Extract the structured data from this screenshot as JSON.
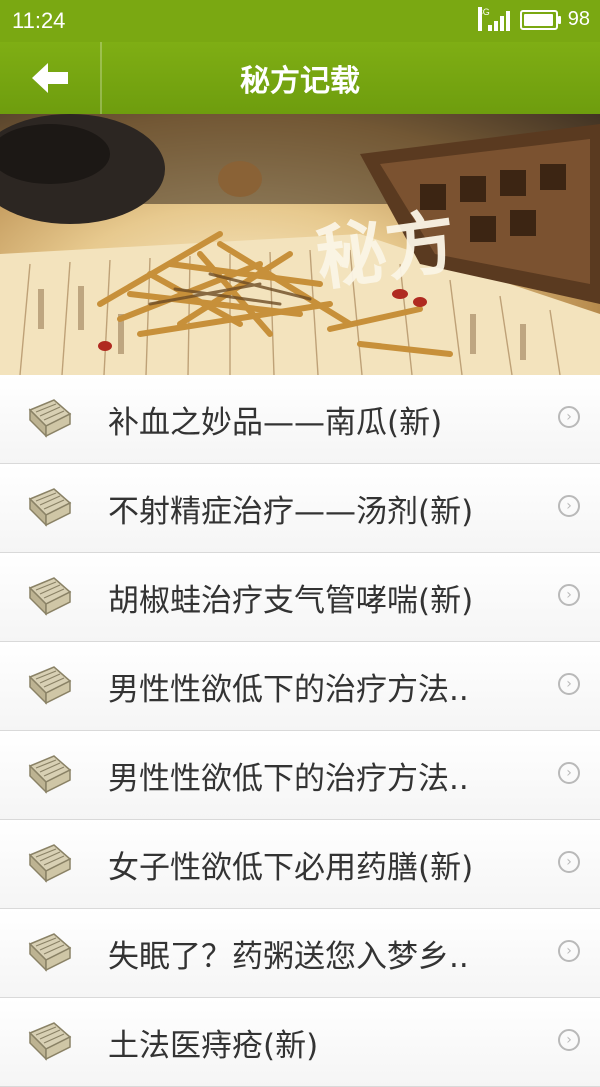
{
  "status_bar": {
    "time": "11:24",
    "network": "3G",
    "battery": "98",
    "battery_level": 0.98
  },
  "header": {
    "title": "秘方记载",
    "back_icon": "arrow-left-icon",
    "accent_color": "#7aa812"
  },
  "banner": {
    "calligraphy": "秘方"
  },
  "list": {
    "items": [
      {
        "label": "补血之妙品——南瓜(新)"
      },
      {
        "label": "不射精症治疗——汤剂(新)"
      },
      {
        "label": "胡椒蛙治疗支气管哮喘(新)"
      },
      {
        "label": "男性性欲低下的治疗方法.."
      },
      {
        "label": "男性性欲低下的治疗方法.."
      },
      {
        "label": "女子性欲低下必用药膳(新)"
      },
      {
        "label": "失眠了？药粥送您入梦乡.."
      },
      {
        "label": "土法医痔疮(新)"
      }
    ],
    "item_icon": "scroll-book-icon",
    "arrow_icon": "chevron-right-circle-icon"
  }
}
